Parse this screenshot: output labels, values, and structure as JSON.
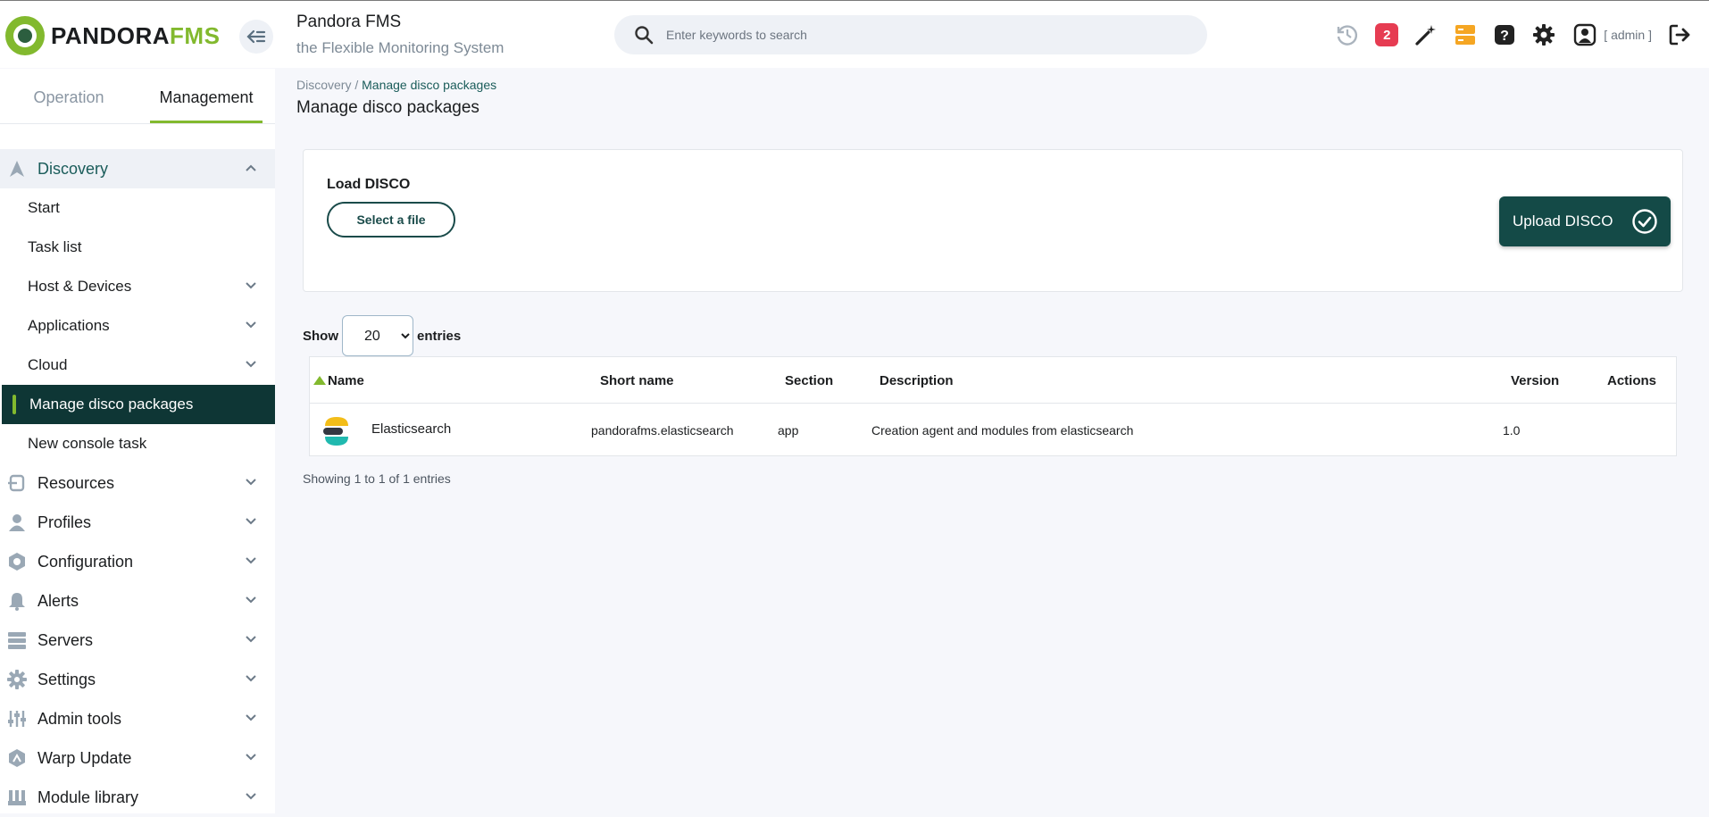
{
  "header": {
    "logo_text": "PANDORA",
    "logo_text_accent": "FMS",
    "title": "Pandora FMS",
    "subtitle": "the Flexible Monitoring System",
    "search_placeholder": "Enter keywords to search",
    "notification_count": "2",
    "user": "[ admin ]"
  },
  "sidebar": {
    "tabs": [
      {
        "label": "Operation"
      },
      {
        "label": "Management"
      }
    ],
    "discovery": {
      "label": "Discovery",
      "items": [
        {
          "label": "Start"
        },
        {
          "label": "Task list"
        },
        {
          "label": "Host & Devices"
        },
        {
          "label": "Applications"
        },
        {
          "label": "Cloud"
        },
        {
          "label": "Manage disco packages"
        },
        {
          "label": "New console task"
        }
      ]
    },
    "sections": [
      {
        "label": "Resources",
        "icon": "resources-icon"
      },
      {
        "label": "Profiles",
        "icon": "user-icon"
      },
      {
        "label": "Configuration",
        "icon": "configuration-icon"
      },
      {
        "label": "Alerts",
        "icon": "bell-icon"
      },
      {
        "label": "Servers",
        "icon": "servers-icon"
      },
      {
        "label": "Settings",
        "icon": "gear-icon"
      },
      {
        "label": "Admin tools",
        "icon": "sliders-icon"
      },
      {
        "label": "Warp Update",
        "icon": "warp-update-icon"
      },
      {
        "label": "Module library",
        "icon": "module-library-icon"
      }
    ]
  },
  "main": {
    "breadcrumb_root": "Discovery /",
    "breadcrumb_current": "Manage disco packages",
    "page_title": "Manage disco packages",
    "load_label": "Load DISCO",
    "select_file": "Select a file",
    "upload_label": "Upload DISCO",
    "show_label": "Show",
    "entries_label": "entries",
    "page_size": "20",
    "table": {
      "columns": [
        "Name",
        "Short name",
        "Section",
        "Description",
        "Version",
        "Actions"
      ],
      "rows": [
        {
          "name": "Elasticsearch",
          "short_name": "pandorafms.elasticsearch",
          "section": "app",
          "description": "Creation agent and modules from elasticsearch",
          "version": "1.0"
        }
      ]
    },
    "showing": "Showing 1 to 1 of 1 entries"
  },
  "colors": {
    "accent": "#82b92e",
    "active_dark": "#0e3635",
    "button_dark": "#144a47",
    "badge": "#e63c52"
  }
}
